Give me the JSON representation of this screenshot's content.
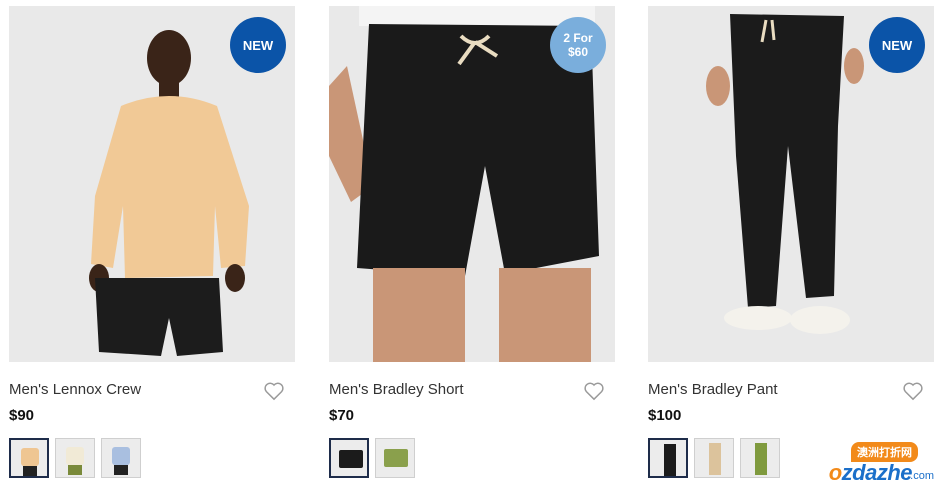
{
  "products": [
    {
      "name": "Men's Lennox Crew",
      "price": "$90",
      "badge_line1": "NEW",
      "badge_line2": "",
      "badge_style": "new",
      "swatch_count": 3,
      "selected_swatch": 0
    },
    {
      "name": "Men's Bradley Short",
      "price": "$70",
      "badge_line1": "2 For",
      "badge_line2": "$60",
      "badge_style": "promo",
      "swatch_count": 2,
      "selected_swatch": 0
    },
    {
      "name": "Men's Bradley Pant",
      "price": "$100",
      "badge_line1": "NEW",
      "badge_line2": "",
      "badge_style": "new",
      "swatch_count": 3,
      "selected_swatch": 0
    }
  ],
  "watermark": {
    "cn_text": "澳洲打折网",
    "logo_o": "o",
    "logo_rest": "zdazhe",
    "domain": ".com"
  },
  "colors": {
    "badge_new": "#0b54a8",
    "badge_promo": "#7aaedc",
    "selected_border": "#1e2c4a",
    "photo_bg": "#e9e9e9"
  }
}
